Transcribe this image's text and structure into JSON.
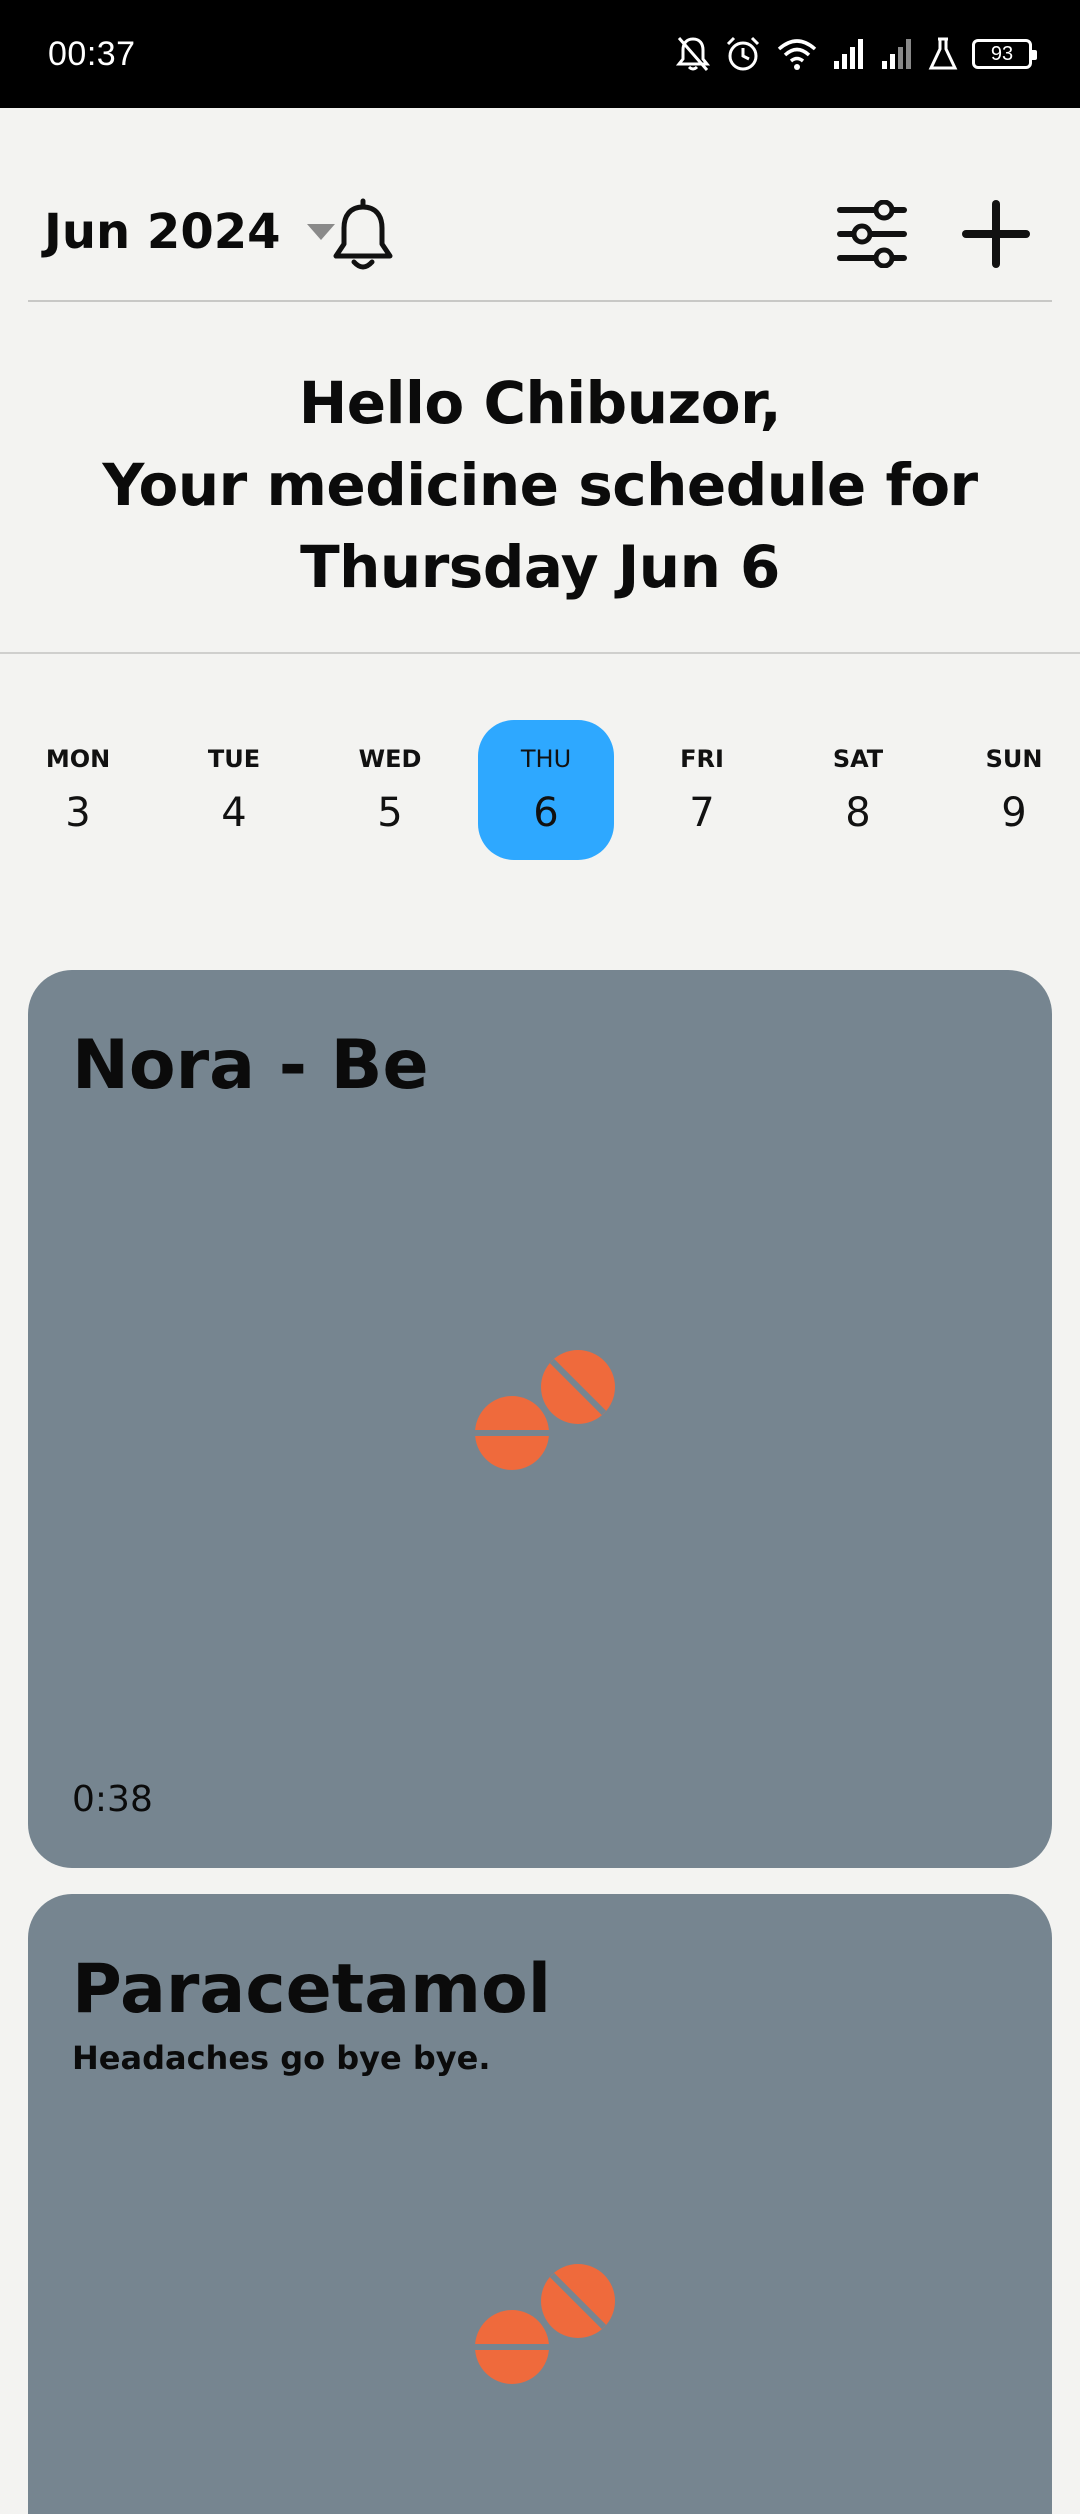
{
  "status_bar": {
    "time": "00:37",
    "battery": "93"
  },
  "header": {
    "month": "Jun 2024"
  },
  "greeting": {
    "line1": "Hello Chibuzor,",
    "line2": "Your medicine schedule for",
    "line3": "Thursday Jun 6"
  },
  "week": {
    "days": [
      {
        "dow": "MON",
        "date": "3"
      },
      {
        "dow": "TUE",
        "date": "4"
      },
      {
        "dow": "WED",
        "date": "5"
      },
      {
        "dow": "THU",
        "date": "6"
      },
      {
        "dow": "FRI",
        "date": "7"
      },
      {
        "dow": "SAT",
        "date": "8"
      },
      {
        "dow": "SUN",
        "date": "9"
      }
    ],
    "selected_index": 3
  },
  "medicines": [
    {
      "name": "Nora - Be",
      "note": "",
      "time": "0:38"
    },
    {
      "name": "Paracetamol",
      "note": "Headaches go bye bye.",
      "time": ""
    }
  ],
  "colors": {
    "accent": "#2ea8ff",
    "card": "#768590",
    "pill": "#ef6a3c"
  }
}
